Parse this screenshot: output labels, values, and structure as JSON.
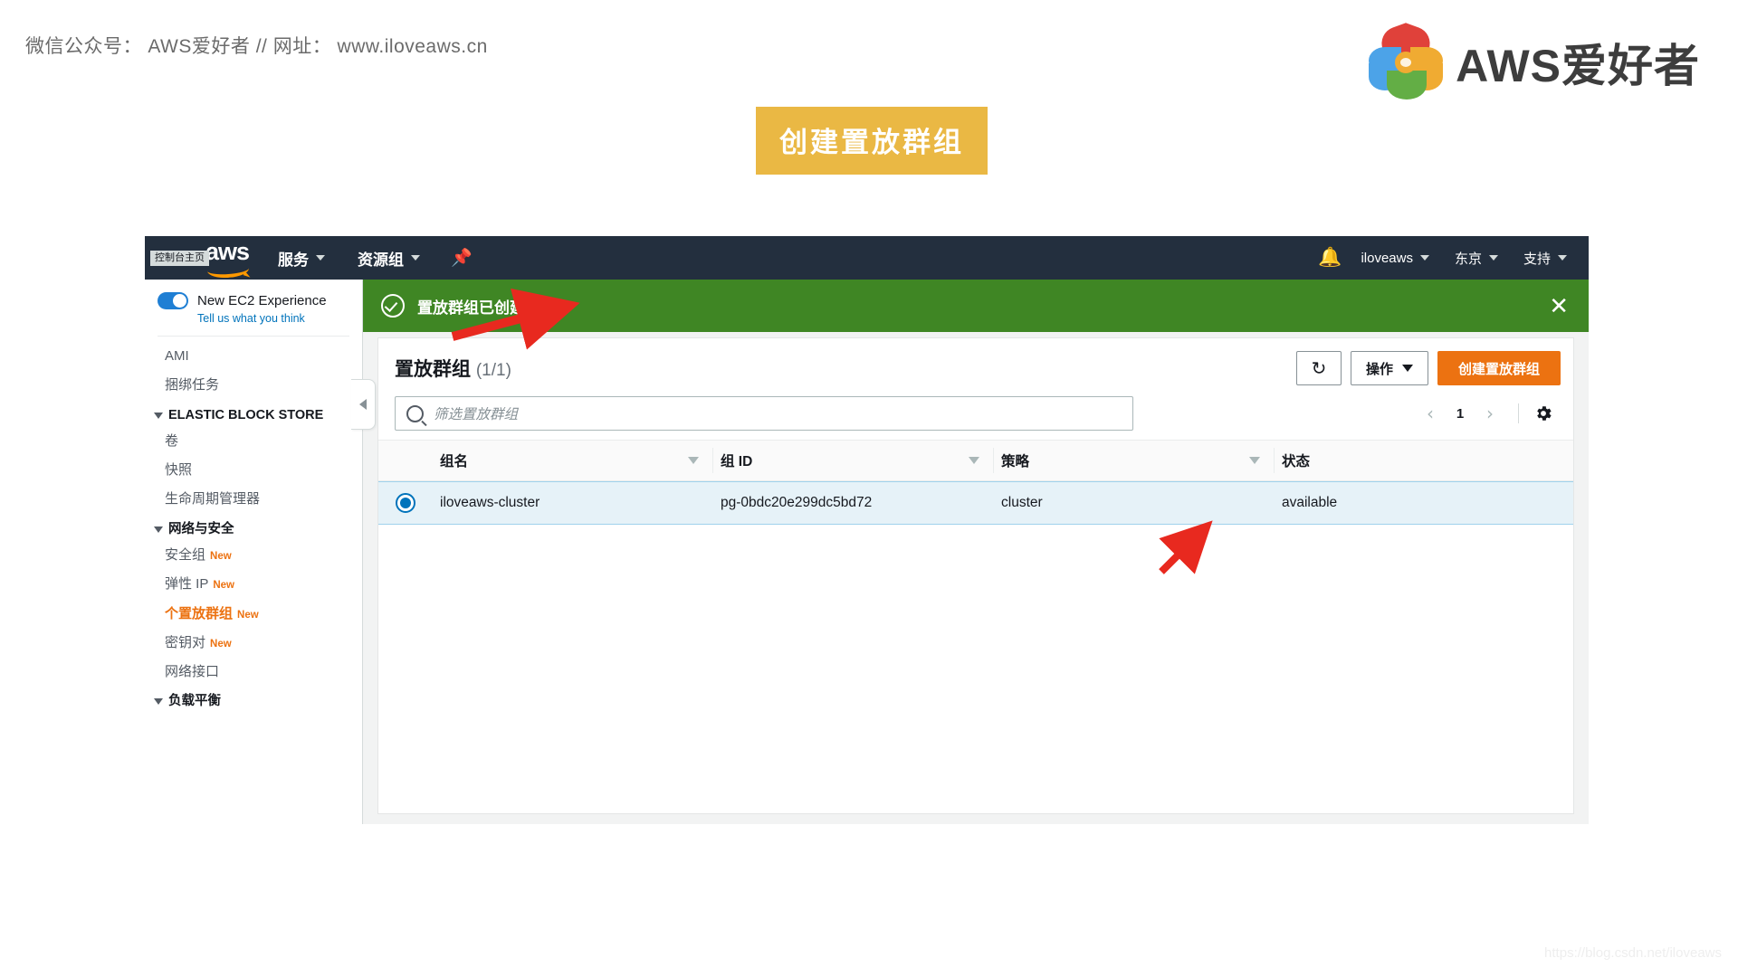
{
  "header": {
    "wechat_line": "微信公众号： AWS爱好者  //  网址： www.iloveaws.cn",
    "brand_text": "AWS爱好者",
    "title_banner": "创建置放群组"
  },
  "console": {
    "topnav": {
      "home_tooltip": "控制台主页",
      "logo_word": "aws",
      "services": "服务",
      "resource_groups": "资源组",
      "pin_icon": "pin-icon",
      "bell_icon": "bell-icon",
      "account": "iloveaws",
      "region": "东京",
      "support": "支持"
    },
    "sidebar": {
      "new_experience_label": "New EC2 Experience",
      "feedback_link": "Tell us what you think",
      "items": [
        {
          "label": "AMI",
          "type": "item",
          "active": false,
          "new": false
        },
        {
          "label": "捆绑任务",
          "type": "item",
          "active": false,
          "new": false
        },
        {
          "label": "ELASTIC BLOCK STORE",
          "type": "group"
        },
        {
          "label": "卷",
          "type": "item",
          "active": false,
          "new": false
        },
        {
          "label": "快照",
          "type": "item",
          "active": false,
          "new": false
        },
        {
          "label": "生命周期管理器",
          "type": "item",
          "active": false,
          "new": false
        },
        {
          "label": "网络与安全",
          "type": "group"
        },
        {
          "label": "安全组",
          "type": "item",
          "active": false,
          "new": true
        },
        {
          "label": "弹性 IP",
          "type": "item",
          "active": false,
          "new": true
        },
        {
          "label": "个置放群组",
          "type": "item",
          "active": true,
          "new": true
        },
        {
          "label": "密钥对",
          "type": "item",
          "active": false,
          "new": true
        },
        {
          "label": "网络接口",
          "type": "item",
          "active": false,
          "new": false
        },
        {
          "label": "负载平衡",
          "type": "group"
        }
      ],
      "new_badge": "New",
      "collapse_icon": "chevron-left-icon"
    },
    "flash": {
      "icon": "success-check-icon",
      "message": "置放群组已创建成功。",
      "close_icon": "close-icon"
    },
    "panel": {
      "title": "置放群组",
      "count": "(1/1)",
      "refresh_icon": "refresh-icon",
      "actions_label": "操作",
      "create_label": "创建置放群组",
      "search_placeholder": "筛选置放群组",
      "search_value": "",
      "search_icon": "search-icon",
      "pager": {
        "prev_icon": "chevron-left-icon",
        "page": "1",
        "next_icon": "chevron-right-icon",
        "settings_icon": "gear-icon"
      },
      "table": {
        "columns": [
          "组名",
          "组 ID",
          "策略",
          "状态"
        ],
        "rows": [
          {
            "selected": true,
            "name": "iloveaws-cluster",
            "id": "pg-0bdc20e299dc5bd72",
            "policy": "cluster",
            "status": "available"
          }
        ]
      }
    }
  },
  "annotations": {
    "arrow_color": "#e8291f",
    "arrow_1_target": "flash-message",
    "arrow_2_target": "policy-cell"
  },
  "watermark": "https://blog.csdn.net/iloveaws",
  "colors": {
    "nav_bg": "#232f3e",
    "flash_green": "#3f8624",
    "accent_orange": "#ec7211",
    "banner_gold": "#eab844",
    "row_selected": "#e6f2f8"
  }
}
